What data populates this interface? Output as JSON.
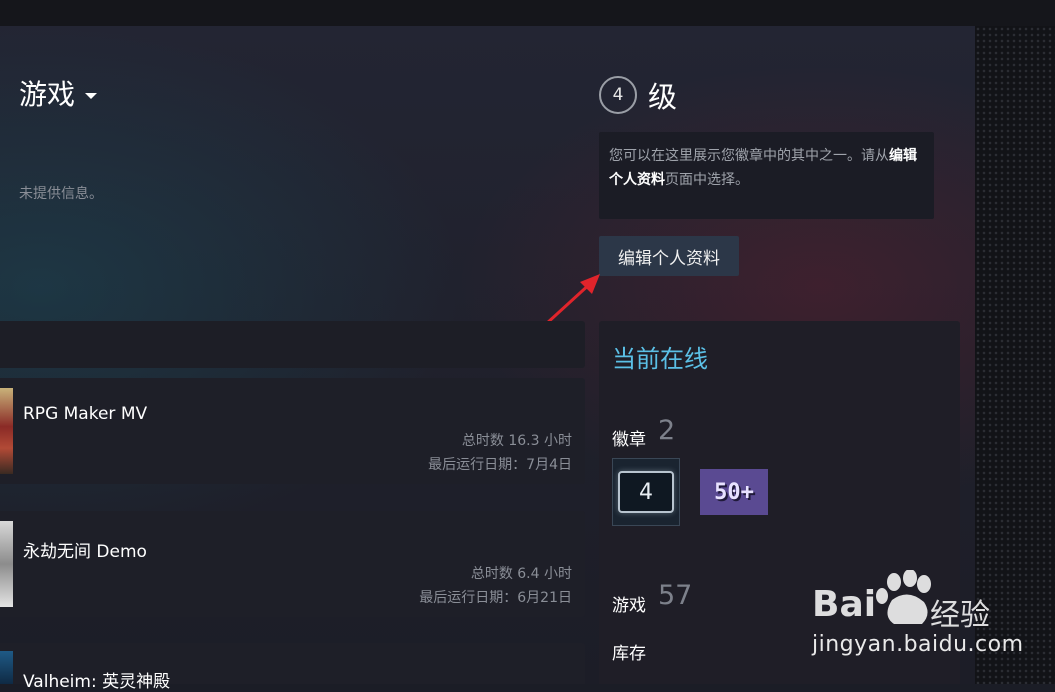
{
  "header": {
    "section_title": "游戏"
  },
  "profile": {
    "no_info": "未提供信息。"
  },
  "level": {
    "value": "4",
    "label": "级"
  },
  "notice": {
    "part1": "您可以在这里展示您徽章中的其中之一。请从",
    "link": "编辑个人资料",
    "part2": "页面中选择。"
  },
  "edit_button": "编辑个人资料",
  "games": [
    {
      "name": "RPG Maker MV",
      "hours": "总时数 16.3 小时",
      "last_played": "最后运行日期：7月4日"
    },
    {
      "name": "永劫无间 Demo",
      "hours": "总时数 6.4 小时",
      "last_played": "最后运行日期：6月21日"
    },
    {
      "name": "Valheim: 英灵神殿"
    }
  ],
  "sidebar": {
    "status": "当前在线",
    "badges_label": "徽章",
    "badges_count": "2",
    "badge_items": [
      "4",
      "50+"
    ],
    "games_label": "游戏",
    "games_count": "57",
    "inventory_label": "库存"
  },
  "watermark": {
    "brand": "Bai",
    "brand_suffix": "经验",
    "url": "jingyan.baidu.com"
  },
  "colors": {
    "accent_online": "#5bc0e6",
    "arrow": "#e0242b",
    "button_bg": "#2c3748"
  }
}
